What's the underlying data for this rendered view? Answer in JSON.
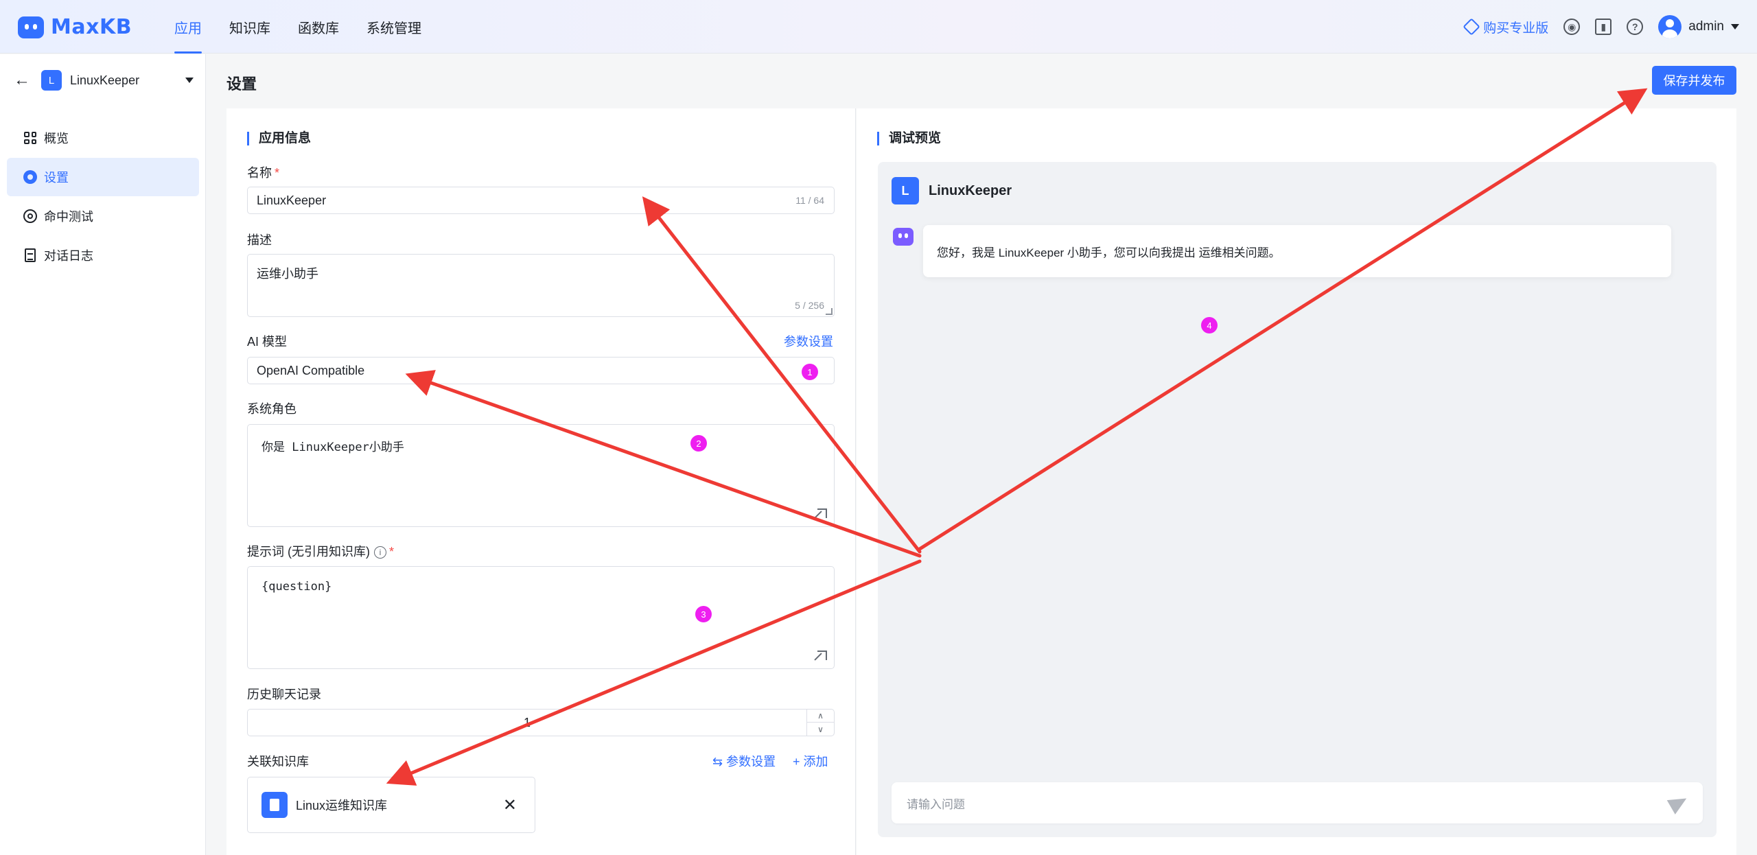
{
  "header": {
    "logo_text": "MaxKB",
    "nav": [
      "应用",
      "知识库",
      "函数库",
      "系统管理"
    ],
    "buy_label": "购买专业版",
    "user_name": "admin"
  },
  "sidebar": {
    "app_icon_letter": "L",
    "app_name": "LinuxKeeper",
    "items": [
      "概览",
      "设置",
      "命中测试",
      "对话日志"
    ]
  },
  "page": {
    "title": "设置",
    "save_publish_label": "保存并发布"
  },
  "form": {
    "section_title": "应用信息",
    "name_label": "名称",
    "name_required": "*",
    "name_value": "LinuxKeeper",
    "name_counter": "11 / 64",
    "desc_label": "描述",
    "desc_value": "运维小助手",
    "desc_counter": "5 / 256",
    "model_label": "AI 模型",
    "model_params_link": "参数设置",
    "model_value": "OpenAI Compatible",
    "role_label": "系统角色",
    "role_value": "你是 LinuxKeeper小助手",
    "prompt_label": "提示词 (无引用知识库)",
    "prompt_required": "*",
    "info_glyph": "i",
    "prompt_value": "{question}",
    "history_label": "历史聊天记录",
    "history_value": "1",
    "kb_label": "关联知识库",
    "kb_params_link": "参数设置",
    "kb_add_link": "添加",
    "kb_item": "Linux运维知识库"
  },
  "preview": {
    "section_title": "调试预览",
    "app_icon_letter": "L",
    "app_name": "LinuxKeeper",
    "greeting": "您好，我是 LinuxKeeper 小助手，您可以向我提出 运维相关问题。",
    "input_placeholder": "请输入问题"
  },
  "annotations": {
    "badges": [
      "1",
      "2",
      "3",
      "4"
    ],
    "arrow_color": "#ee3a34",
    "badge_color": "#ee1ff0"
  },
  "colors": {
    "accent": "#3370ff",
    "required": "#f54a45"
  }
}
